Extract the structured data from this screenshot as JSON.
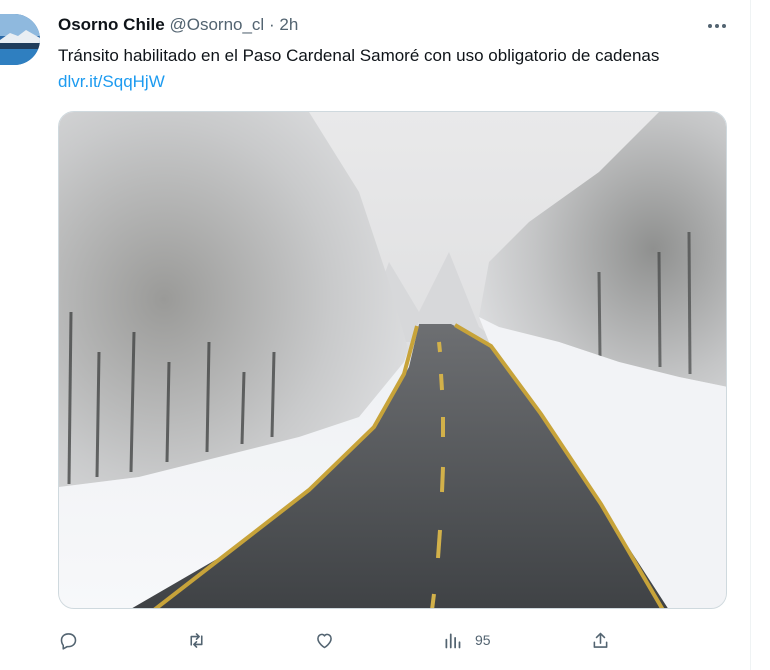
{
  "tweet": {
    "display_name": "Osorno Chile",
    "handle": "@Osorno_cl",
    "separator": "·",
    "time": "2h",
    "text": "Tránsito habilitado en el Paso Cardenal Samoré con uso obligatorio de cadenas",
    "link": "dlvr.it/SqqHjW",
    "more_icon": "more-horizontal-icon",
    "actions": {
      "reply_icon": "reply-icon",
      "retweet_icon": "retweet-icon",
      "like_icon": "heart-icon",
      "views_icon": "views-chart-icon",
      "views_count": "95",
      "share_icon": "share-icon"
    },
    "colors": {
      "link": "#1d9bf0",
      "muted": "#536471",
      "text": "#0f1419"
    }
  }
}
